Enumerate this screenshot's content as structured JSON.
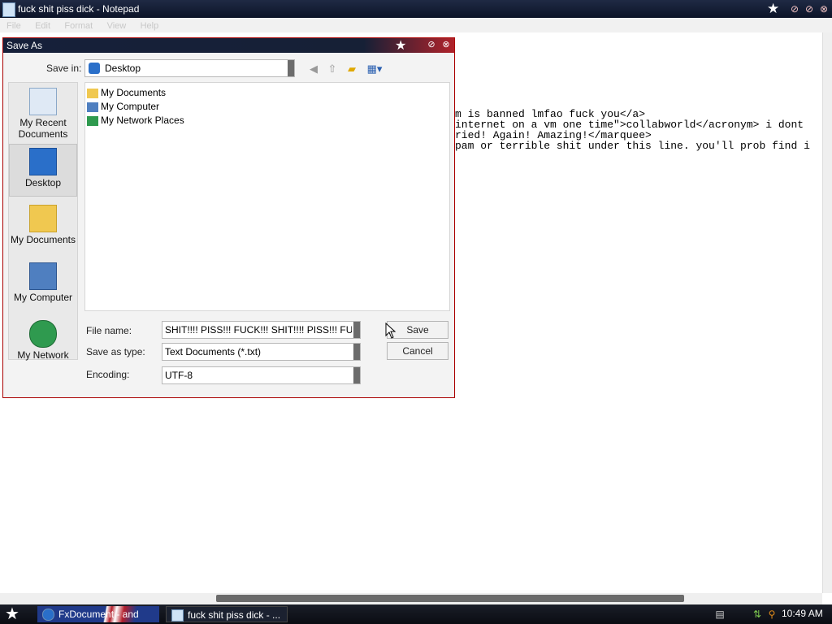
{
  "notepad": {
    "title": "fuck shit piss dick - Notepad",
    "menu": [
      "File",
      "Edit",
      "Format",
      "View",
      "Help"
    ],
    "lines": [
      "m is banned lmfao fuck you</a>",
      "internet on a vm one time\">collabworld</acronym> i dont",
      "ried! Again! Amazing!</marquee>",
      "pam or terrible shit under this line. you'll prob find i"
    ]
  },
  "dialog": {
    "title": "Save As",
    "save_in_label": "Save in:",
    "save_in_value": "Desktop",
    "places": [
      {
        "label": "My Recent Documents"
      },
      {
        "label": "Desktop"
      },
      {
        "label": "My Documents"
      },
      {
        "label": "My Computer"
      },
      {
        "label": "My Network"
      }
    ],
    "files": [
      "My Documents",
      "My Computer",
      "My Network Places"
    ],
    "file_name_label": "File name:",
    "file_name_value": "SHIT!!!! PISS!!! FUCK!!! SHIT!!!! PISS!!! FUCK!!!",
    "save_type_label": "Save as type:",
    "save_type_value": "Text Documents (*.txt)",
    "encoding_label": "Encoding:",
    "encoding_value": "UTF-8",
    "save_button": "Save",
    "cancel_button": "Cancel"
  },
  "taskbar": {
    "items": [
      "FxDocument - and",
      "fuck shit piss dick - ..."
    ],
    "clock": "10:49 AM"
  },
  "colors": {
    "title_bar": "#0c1428",
    "dialog_accent": "#b0222a",
    "taskbar": "#0a0c12"
  }
}
